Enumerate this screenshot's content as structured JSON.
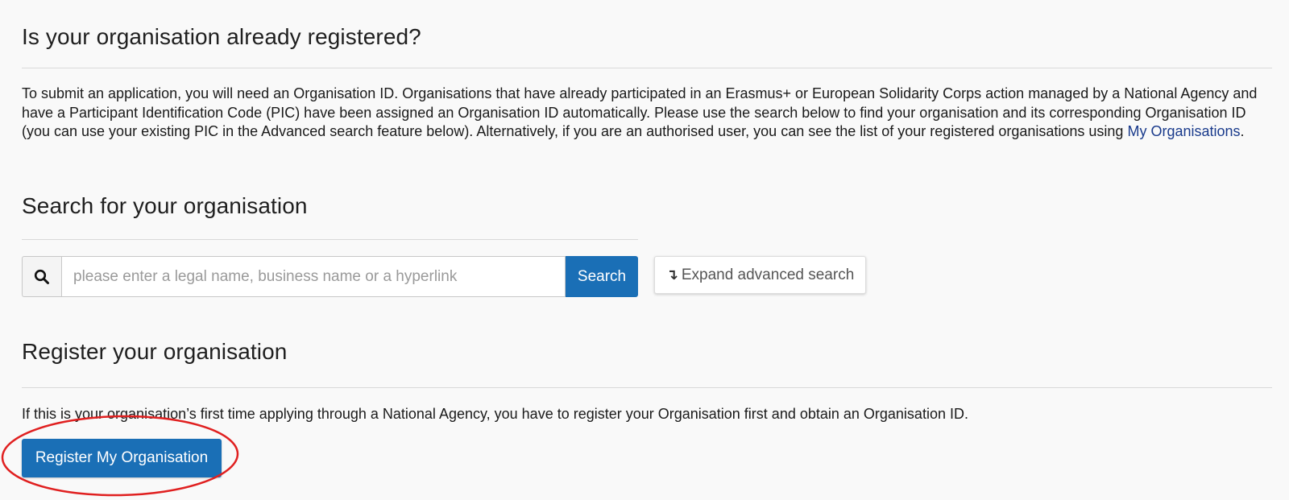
{
  "section_existing": {
    "title": "Is your organisation already registered?",
    "intro_before_link": "To submit an application, you will need an Organisation ID. Organisations that have already participated in an Erasmus+ or European Solidarity Corps action managed by a National Agency and have a Participant Identification Code (PIC) have been assigned an Organisation ID automatically. Please use the search below to find your organisation and its corresponding Organisation ID (you can use your existing PIC in the Advanced search feature below). Alternatively, if you are an authorised user, you can see the list of your registered organisations using ",
    "intro_link": "My Organisations",
    "intro_after_link": "."
  },
  "section_search": {
    "title": "Search for your organisation",
    "icon": "search-icon",
    "input_placeholder": "please enter a legal name, business name or a hyperlink",
    "input_value": "",
    "search_label": "Search",
    "advanced_arrow": "↴",
    "advanced_label": "Expand advanced search"
  },
  "section_register": {
    "title": "Register your organisation",
    "text": "If this is your organisation’s first time applying through a National Agency, you have to register your Organisation first and obtain an Organisation ID.",
    "button_label": "Register My Organisation"
  },
  "colors": {
    "primary": "#1a6fb6",
    "link": "#1a3b8c",
    "highlight": "#e02020",
    "background": "#f9f9f9"
  }
}
